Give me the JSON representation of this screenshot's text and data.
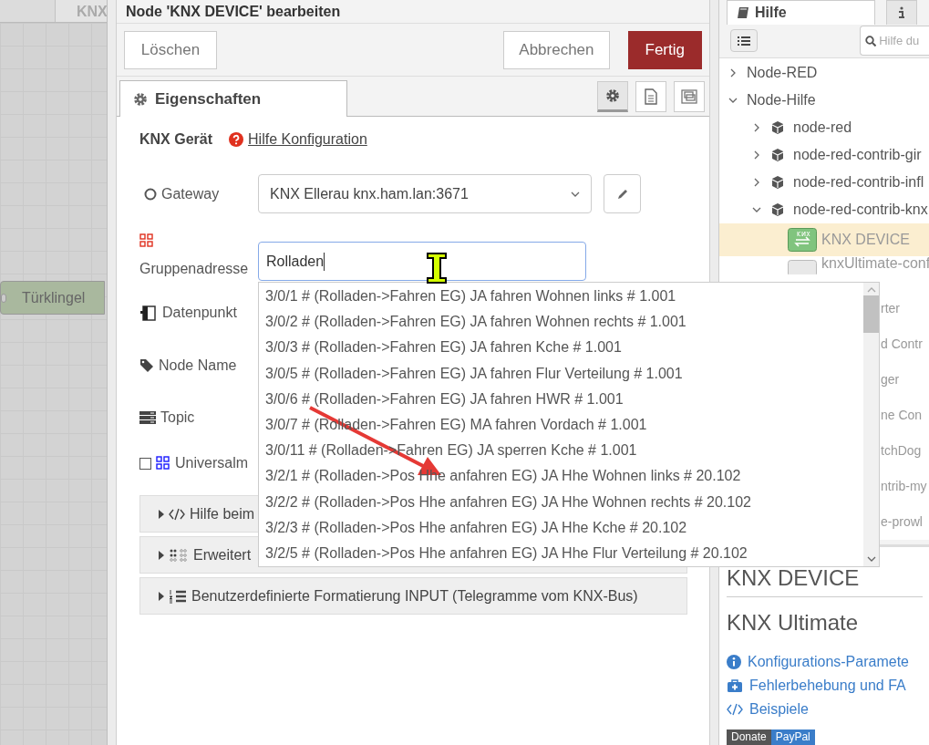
{
  "canvas": {
    "tab": "KNX",
    "node": "Türklingel"
  },
  "dialog": {
    "title": "Node 'KNX DEVICE' bearbeiten",
    "buttons": [
      {
        "label": "Löschen",
        "kind": "plain"
      },
      {
        "label": "Abbrechen",
        "kind": "plain"
      },
      {
        "label": "Fertig",
        "kind": "primary"
      }
    ],
    "tabs": [
      {
        "label": "Eigenschaften",
        "selected": true
      }
    ],
    "tab_tools": [
      {
        "kind": "gear",
        "selected": true
      },
      {
        "kind": "document",
        "selected": false
      },
      {
        "kind": "frame",
        "selected": false
      }
    ],
    "heading": "KNX Gerät",
    "help_link": "Hilfe Konfiguration",
    "fields": [
      {
        "kind": "select",
        "label": "Gateway",
        "value": "KNX Ellerau knx.ham.lan:3671"
      },
      {
        "kind": "input",
        "label": "Gruppenadresse",
        "value": "Rolladen",
        "focused": true
      },
      {
        "kind": "plain",
        "label": "Datenpunkt"
      },
      {
        "kind": "plain",
        "label": "Node Name"
      },
      {
        "kind": "plain",
        "label": "Topic"
      },
      {
        "kind": "checkbox",
        "label": "Universalm",
        "checked": false
      }
    ],
    "sections": [
      {
        "kind": "code",
        "label": "Hilfe beim",
        "expanded": false
      },
      {
        "kind": "dots",
        "label": "Erweitert",
        "expanded": false
      },
      {
        "kind": "list",
        "label": "Benutzerdefinierte Formatierung INPUT (Telegramme vom KNX-Bus)",
        "expanded": false
      }
    ],
    "suggestions": [
      "3/0/1 # (Rolladen->Fahren EG) JA fahren Wohnen links # 1.001",
      "3/0/2 # (Rolladen->Fahren EG) JA fahren Wohnen rechts # 1.001",
      "3/0/3 # (Rolladen->Fahren EG) JA fahren Kche # 1.001",
      "3/0/5 # (Rolladen->Fahren EG) JA fahren Flur Verteilung # 1.001",
      "3/0/6 # (Rolladen->Fahren EG) JA fahren HWR # 1.001",
      "3/0/7 # (Rolladen->Fahren EG) MA fahren Vordach # 1.001",
      "3/0/11 # (Rolladen->Fahren EG) JA sperren Kche # 1.001",
      "3/2/1 # (Rolladen->Pos Hhe anfahren EG) JA Hhe Wohnen links # 20.102",
      "3/2/2 # (Rolladen->Pos Hhe anfahren EG) JA Hhe Wohnen rechts # 20.102",
      "3/2/3 # (Rolladen->Pos Hhe anfahren EG) JA Hhe Kche # 20.102",
      "3/2/5 # (Rolladen->Pos Hhe anfahren EG) JA Hhe Flur Verteilung # 20.102"
    ]
  },
  "sidebar": {
    "tabs": [
      {
        "kind": "help",
        "label": "Hilfe",
        "selected": true
      },
      {
        "kind": "info",
        "selected": false
      }
    ],
    "search": {
      "placeholder": "Hilfe du"
    },
    "tree": [
      {
        "label": "Node-RED",
        "expanded": false
      },
      {
        "label": "Node-Hilfe",
        "expanded": true,
        "children": [
          {
            "label": "node-red",
            "expanded": false
          },
          {
            "label": "node-red-contrib-gir",
            "expanded": false
          },
          {
            "label": "node-red-contrib-infl",
            "expanded": false
          },
          {
            "label": "node-red-contrib-knx",
            "expanded": true,
            "children": [
              {
                "label": "KNX DEVICE",
                "kind": "knx",
                "selected": true
              },
              {
                "label": "knxUltimate-conf",
                "kind": "config",
                "selected": false
              }
            ]
          }
        ]
      }
    ],
    "covered_rows": [
      "rter",
      "d Contr",
      "ger",
      "ne Con",
      "tchDog",
      "ntrib-my",
      "e-prowl"
    ],
    "help": {
      "title": "KNX DEVICE",
      "subtitle": "KNX Ultimate",
      "links": [
        {
          "kind": "info",
          "label": "Konfigurations-Paramete"
        },
        {
          "kind": "medkit",
          "label": "Fehlerbehebung und FA"
        },
        {
          "kind": "code",
          "label": "Beispiele"
        }
      ],
      "badge": [
        "Donate",
        "PayPal"
      ]
    }
  }
}
